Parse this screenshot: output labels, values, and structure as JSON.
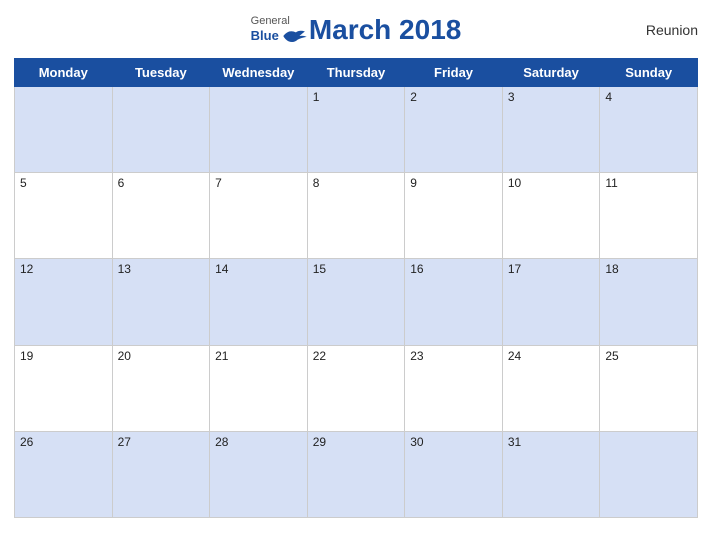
{
  "header": {
    "title": "March 2018",
    "region": "Reunion",
    "logo_general": "General",
    "logo_blue": "Blue"
  },
  "weekdays": [
    "Monday",
    "Tuesday",
    "Wednesday",
    "Thursday",
    "Friday",
    "Saturday",
    "Sunday"
  ],
  "weeks": [
    [
      null,
      null,
      null,
      1,
      2,
      3,
      4
    ],
    [
      5,
      6,
      7,
      8,
      9,
      10,
      11
    ],
    [
      12,
      13,
      14,
      15,
      16,
      17,
      18
    ],
    [
      19,
      20,
      21,
      22,
      23,
      24,
      25
    ],
    [
      26,
      27,
      28,
      29,
      30,
      31,
      null
    ]
  ]
}
